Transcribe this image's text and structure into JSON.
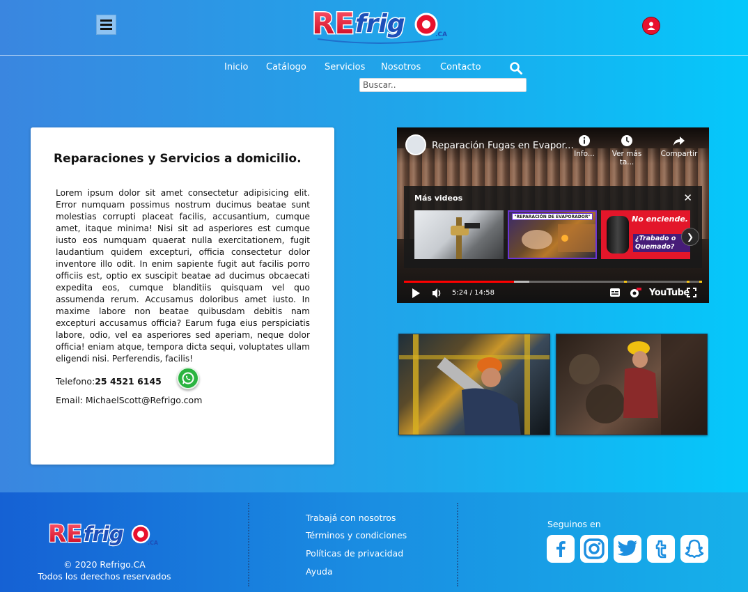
{
  "brand": {
    "logo_text_re": "RE",
    "logo_text_frigo": "frigo",
    "logo_suffix": ".CA"
  },
  "nav": {
    "items": [
      "Inicio",
      "Catálogo",
      "Servicios",
      "Nosotros",
      "Contacto"
    ],
    "search_placeholder": "Buscar.."
  },
  "card": {
    "title": "Reparaciones y Servicios a domicilio.",
    "body": "Lorem ipsum dolor sit amet consectetur adipisicing elit. Error numquam possimus nostrum ducimus beatae sunt molestias corrupti placeat facilis, accusantium, cumque amet, itaque minima! Nisi sit ad asperiores est cumque iusto eos numquam quaerat nulla exercitationem, fugit laudantium quidem excepturi, officia consectetur dolor inventore illo odit. In enim sapiente fugit aut facilis porro officiis est, optio ex suscipit beatae ad ducimus obcaecati expedita eos, cumque blanditiis quisquam vel quo assumenda rerum. Accusamus doloribus amet iusto. In maxime labore non beatae quibusdam debitis nam excepturi accusamus officia? Earum fuga eius perspiciatis labore, odio, vel ea asperiores sed aperiam, neque dolor officia! eniam atque, tempora dicta sequi, voluptates ullam eligendi nisi. Perferendis, facilis!",
    "phone_label": "Telefono:",
    "phone_value": "25 4521 6145",
    "email_label": "Email: ",
    "email_value": "MichaelScott@Refrigo.com"
  },
  "video": {
    "title": "Reparación Fugas en Evapor...",
    "actions": [
      "Info...",
      "Ver más ta...",
      "Compartir"
    ],
    "more_title": "Más videos",
    "thumb2_caption": "\"REPARACIÓN DE EVAPORADOR\"",
    "thumb3_line1": "No enciende.",
    "thumb3_line2": "¿Trabado o Quemado?",
    "time": "5:24 / 14:58",
    "progress": 0.37,
    "buffered": 0.37,
    "logo": "YouTube"
  },
  "footer": {
    "copyright": "© 2020 Refrigo.CA",
    "rights": "Todos los derechos reservados",
    "links": [
      "Trabajá con nosotros",
      "Términos y condiciones",
      "Políticas de privacidad",
      "Ayuda"
    ],
    "social_title": "Seguinos en",
    "social": [
      "facebook-icon",
      "instagram-icon",
      "twitter-icon",
      "tumblr-icon",
      "snapchat-icon"
    ]
  },
  "colors": {
    "brand_red": "#e8112d",
    "brand_blue": "#1d4fb8",
    "youtube_red": "#ff0000"
  }
}
